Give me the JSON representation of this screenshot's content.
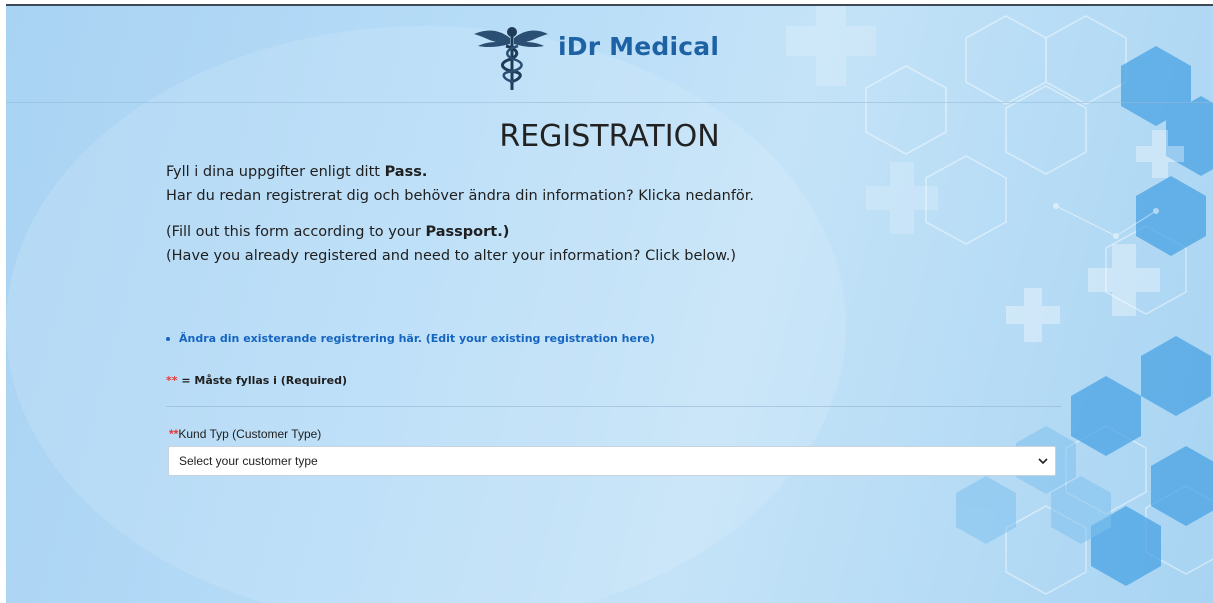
{
  "brand": {
    "name": "iDr Medical",
    "logo_icon": "caduceus-icon"
  },
  "title": "REGISTRATION",
  "intro": {
    "line1_prefix": "Fyll i dina uppgifter enligt ditt ",
    "line1_bold": "Pass.",
    "line2": "Har du redan registrerat dig och behöver ändra din information? Klicka nedanför.",
    "line3_prefix": "(Fill out this form according to your ",
    "line3_bold": "Passport.)",
    "line4": "(Have you already registered and need to alter your information? Click below.)"
  },
  "edit_link": "Ändra din existerande registrering här. (Edit your existing registration here)",
  "required_note": {
    "mark": "**",
    "text": " = Måste fyllas i (Required)"
  },
  "customer_type": {
    "required_mark": "**",
    "label": "Kund Typ (Customer Type)",
    "selected": "Select your customer type"
  },
  "colors": {
    "accent": "#1565c0",
    "brand": "#1e62a6",
    "required": "#e53935",
    "background": "#b6dcf7"
  }
}
